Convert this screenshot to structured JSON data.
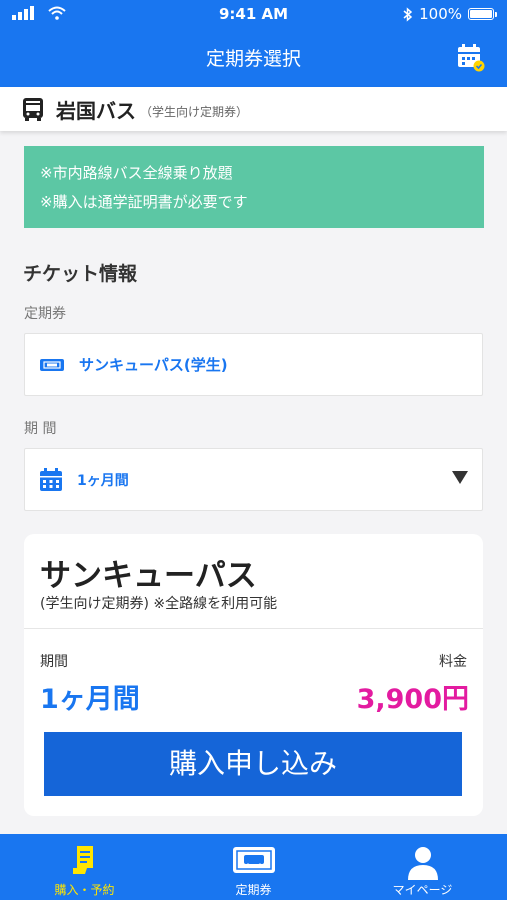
{
  "status_bar": {
    "time": "9:41 AM",
    "battery": "100%"
  },
  "header": {
    "title": "定期券選択"
  },
  "company": {
    "name": "岩国バス",
    "subtitle": "（学生向け定期券）"
  },
  "notice": {
    "lines": [
      "※市内路線バス全線乗り放題",
      "※購入は通学証明書が必要です"
    ]
  },
  "ticket_info": {
    "section_title": "チケット情報",
    "pass_label": "定期券",
    "pass_value": "サンキューパス(学生)",
    "period_label": "期 間",
    "period_value": "1ヶ月間"
  },
  "summary": {
    "title": "サンキューパス",
    "subtitle": "(学生向け定期券) ※全路線を利用可能",
    "period_label": "期間",
    "price_label": "料金",
    "period_value": "1ヶ月間",
    "price_value": "3,900円",
    "buy_label": "購入申し込み"
  },
  "tabs": [
    {
      "label": "購入・予約",
      "icon": "ticket-purchase-icon",
      "active": true
    },
    {
      "label": "定期券",
      "icon": "bus-pass-icon",
      "active": false
    },
    {
      "label": "マイページ",
      "icon": "user-icon",
      "active": false
    }
  ],
  "colors": {
    "primary": "#1976f0",
    "notice": "#5cc7a4",
    "price": "#e31ba0",
    "active_tab": "#ffe500",
    "button": "#1565d8"
  }
}
